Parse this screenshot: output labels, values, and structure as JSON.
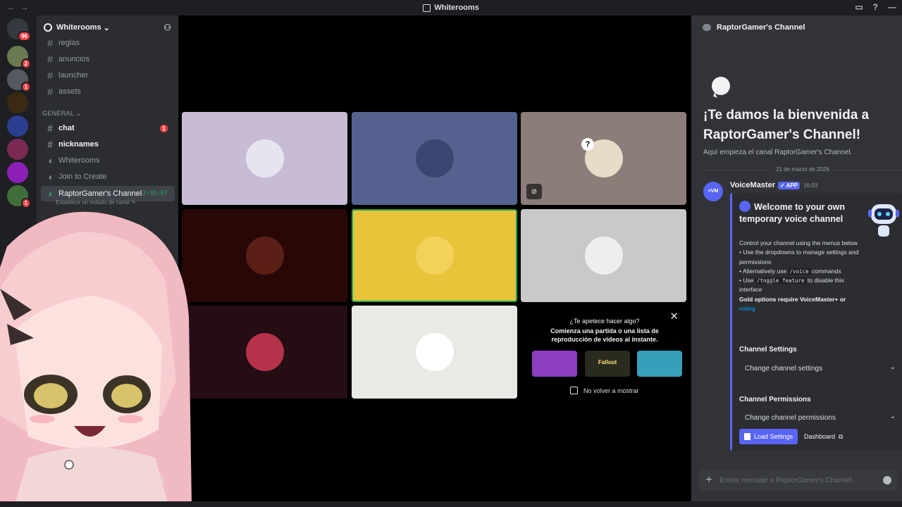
{
  "window": {
    "title": "Whiterooms"
  },
  "servers": [
    {
      "name": "server-home",
      "badge": "96",
      "color": "#36393f"
    },
    {
      "name": "server-2",
      "badge": "2",
      "color": "#6b7a52"
    },
    {
      "name": "server-3",
      "badge": "1",
      "color": "#555a60"
    },
    {
      "name": "server-4",
      "badge": "",
      "color": "#3a2a12"
    },
    {
      "name": "server-5",
      "badge": "",
      "color": "#2a3f8f"
    },
    {
      "name": "server-6",
      "badge": "",
      "color": "#7a2a52"
    },
    {
      "name": "server-7",
      "badge": "",
      "color": "#8c1fb8"
    },
    {
      "name": "server-8",
      "badge": "1",
      "color": "#3f6e3a"
    }
  ],
  "guild": {
    "name": "Whiterooms"
  },
  "channels": {
    "top": [
      {
        "label": "reglas"
      },
      {
        "label": "anuncios"
      },
      {
        "label": "launcher"
      },
      {
        "label": "assets"
      }
    ],
    "category": "GENERAL",
    "general": [
      {
        "label": "chat",
        "unread": "1"
      },
      {
        "label": "nicknames"
      },
      {
        "label": "Whiterooms"
      },
      {
        "label": "Join to Create"
      },
      {
        "label": "RaptorGamer's Channel",
        "timer": "2:45:07"
      }
    ],
    "status_hint": "Establece un estado de canal"
  },
  "tiles": [
    {
      "bg": "#c7bcd4",
      "avatar": "#e8e4ef"
    },
    {
      "bg": "#55628f",
      "avatar": "#3b4670"
    },
    {
      "bg": "#8c7d7a",
      "avatar": "#e6dcc8",
      "question": "?"
    },
    {
      "bg": "#2a0707",
      "avatar": "#5a1f15"
    },
    {
      "bg": "#e7c43a",
      "avatar": "#f4d25a",
      "speaking": true
    },
    {
      "bg": "#c9c9c9",
      "avatar": "#eeeeee"
    },
    {
      "bg": "#250d14",
      "avatar": "#b4324a"
    },
    {
      "bg": "#e9e9e6",
      "avatar": "#ffffff"
    }
  ],
  "activity": {
    "prompt": "¿Te apetece hacer algo?",
    "desc_line1": "Comienza una partida o una lista de",
    "desc_line2": "reproducción de vídeos al instante.",
    "games": [
      {
        "label": "",
        "color": "#8b3fbf"
      },
      {
        "label": "Fallout",
        "color": "#2b2a1e"
      },
      {
        "label": "",
        "color": "#36a0b8"
      }
    ],
    "dont_show": "No volver a mostrar"
  },
  "chat": {
    "channel_name": "RaptorGamer's Channel",
    "welcome_title": "¡Te damos la bienvenida a RaptorGamer's Channel!",
    "welcome_sub": "Aquí empieza el canal RaptorGamer's Channel.",
    "date": "21 de marzo de 2026",
    "message": {
      "author": "VoiceMaster",
      "app_badge": "APP",
      "time": "16:03",
      "embed_title": "Welcome to your own temporary voice channel",
      "intro": "Control your channel using the menus below",
      "bullet1": "• Use the dropdowns to manage settings and permissions",
      "bullet2_pre": "• Alternatively use ",
      "bullet2_code": "/voice",
      "bullet2_post": " commands",
      "bullet3_pre": "• Use ",
      "bullet3_code": "/toggle feature",
      "bullet3_post": " to disable this interface",
      "gold": "Gold options require VoiceMaster+ or",
      "gold_link": "voting",
      "settings_label": "Channel Settings",
      "settings_placeholder": "Change channel settings",
      "permissions_label": "Channel Permissions",
      "permissions_placeholder": "Change channel permissions",
      "load_button": "Load Settings",
      "dashboard_button": "Dashboard"
    },
    "composer_placeholder": "Enviar mensaje a RaptorGamer's Channel"
  }
}
